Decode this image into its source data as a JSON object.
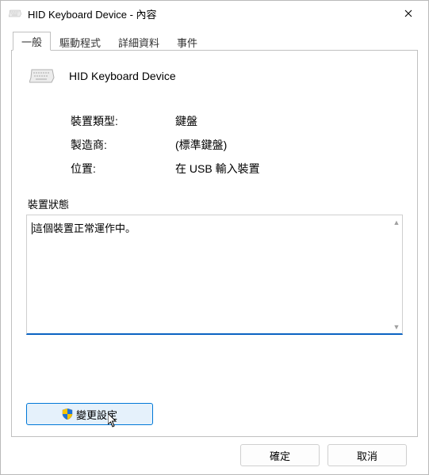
{
  "titlebar": {
    "title": "HID Keyboard Device - 內容"
  },
  "tabs": {
    "general": "一般",
    "driver": "驅動程式",
    "details": "詳細資料",
    "events": "事件"
  },
  "device": {
    "name": "HID Keyboard Device"
  },
  "info": {
    "device_type_label": "裝置類型:",
    "device_type_value": "鍵盤",
    "manufacturer_label": "製造商:",
    "manufacturer_value": "(標準鍵盤)",
    "location_label": "位置:",
    "location_value": "在 USB 輸入裝置"
  },
  "status": {
    "group_label": "裝置狀態",
    "text": "這個裝置正常運作中。"
  },
  "buttons": {
    "change_settings": "變更設定",
    "ok": "確定",
    "cancel": "取消"
  }
}
